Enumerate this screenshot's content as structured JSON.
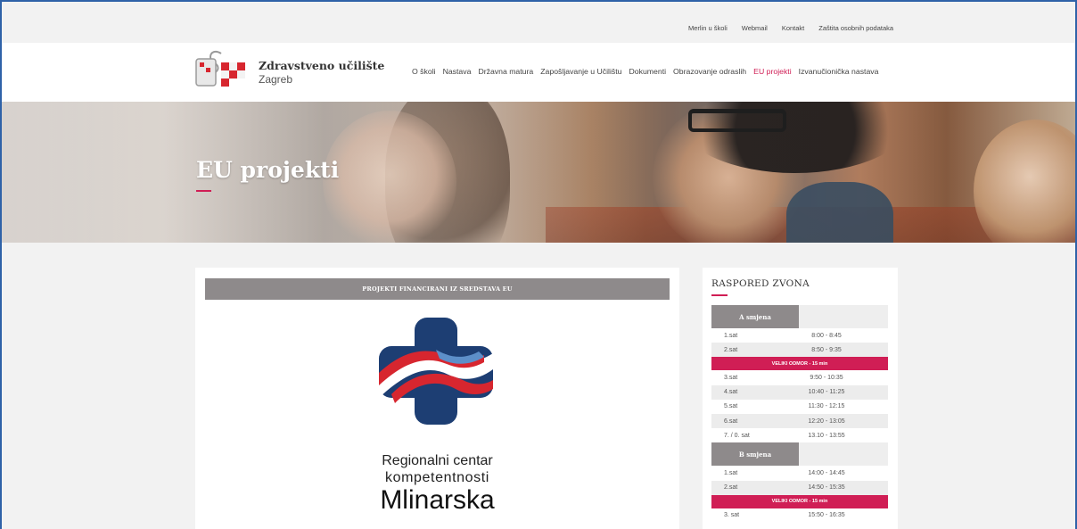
{
  "utility_links": [
    "Merlin u školi",
    "Webmail",
    "Kontakt",
    "Zaštita osobnih podataka"
  ],
  "brand": {
    "name": "Zdravstveno učilište",
    "city": "Zagreb"
  },
  "nav": [
    {
      "label": "O školi",
      "active": false
    },
    {
      "label": "Nastava",
      "active": false
    },
    {
      "label": "Državna matura",
      "active": false
    },
    {
      "label": "Zapošljavanje u Učilištu",
      "active": false
    },
    {
      "label": "Dokumenti",
      "active": false
    },
    {
      "label": "Obrazovanje odraslih",
      "active": false
    },
    {
      "label": "EU projekti",
      "active": true
    },
    {
      "label": "Izvanučionička nastava",
      "active": false
    }
  ],
  "hero": {
    "title": "EU projekti"
  },
  "main": {
    "section_title": "PROJEKTI FINANCIRANI IZ SREDSTAVA EU",
    "project_line1": "Regionalni centar",
    "project_line2": "kompetentnosti",
    "project_line3": "Mlinarska"
  },
  "sidebar": {
    "title": "RASPORED ZVONA",
    "shift_a": "A smjena",
    "a_rows1": [
      {
        "label": "1.sat",
        "time": "8:00 - 8:45"
      },
      {
        "label": "2.sat",
        "time": "8:50 - 9:35"
      }
    ],
    "break_label": "VELIKI ODMOR - 15 min",
    "a_rows2": [
      {
        "label": "3.sat",
        "time": "9:50 - 10:35"
      },
      {
        "label": "4.sat",
        "time": "10:40 - 11:25"
      },
      {
        "label": "5.sat",
        "time": "11:30 - 12:15"
      },
      {
        "label": "6.sat",
        "time": "12:20 - 13:05"
      },
      {
        "label": "7. / 0. sat",
        "time": "13.10 - 13:55"
      }
    ],
    "shift_b": "B smjena",
    "b_rows1": [
      {
        "label": "1.sat",
        "time": "14:00 - 14:45"
      },
      {
        "label": "2.sat",
        "time": "14:50 - 15:35"
      }
    ],
    "b_rows2": [
      {
        "label": "3. sat",
        "time": "15:50 - 16:35"
      }
    ]
  },
  "colors": {
    "accent": "#d01e55",
    "section_bar": "#8e8a8b",
    "page_bg": "#f2f2f2",
    "logo_navy": "#1d3e73",
    "logo_red": "#d7262f"
  }
}
